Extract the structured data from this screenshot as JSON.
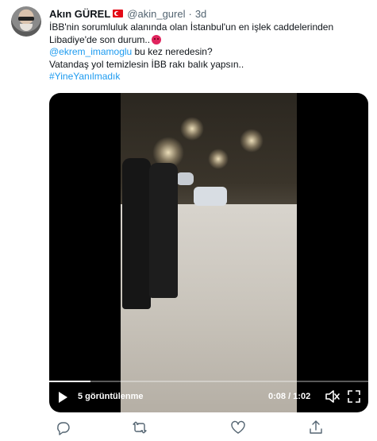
{
  "tweet": {
    "author_name": "Akın GÜREL",
    "author_handle": "@akin_gurel",
    "separator": "·",
    "timestamp": "3d",
    "lines": {
      "line1": "İBB'nin sorumluluk alanında olan İstanbul'un en işlek caddelerinden",
      "line2": "Libadiye'de son durum..",
      "mention": "@ekrem_imamoglu",
      "line3_rest": " bu kez neredesin?",
      "line4": "Vatandaş yol temizlesin İBB rakı balık yapsın..",
      "hashtag": "#YineYanılmadık"
    }
  },
  "video": {
    "views": "5 görüntülenme",
    "timecode": "0:08 / 1:02",
    "progress": 0.13
  },
  "icons": {
    "flag": "turkey-flag-icon",
    "emoji": "angry-face-icon",
    "play": "play-icon",
    "mute": "mute-icon",
    "fullscreen": "fullscreen-icon",
    "reply": "reply-icon",
    "retweet": "retweet-icon",
    "like": "like-icon",
    "share": "share-icon"
  },
  "colors": {
    "link": "#1d9bf0",
    "text": "#0f1419",
    "muted": "#536471",
    "flag": "#e30a17"
  }
}
